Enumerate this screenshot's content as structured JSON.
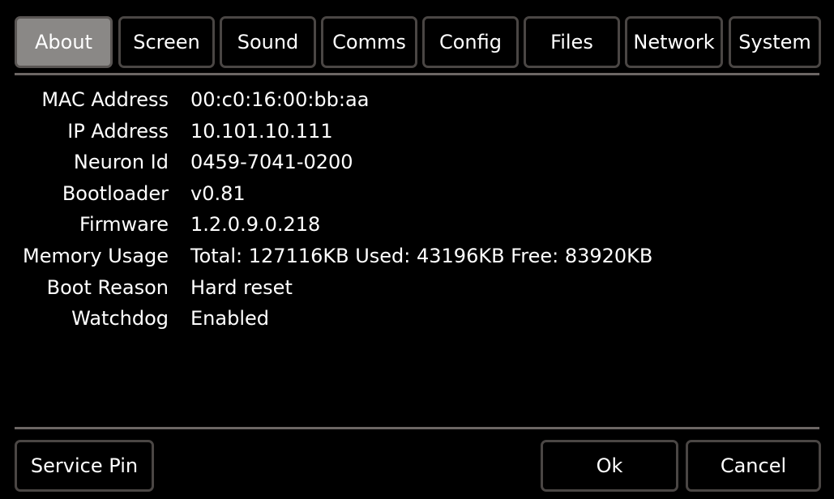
{
  "tabs": [
    {
      "label": "About",
      "active": true
    },
    {
      "label": "Screen",
      "active": false
    },
    {
      "label": "Sound",
      "active": false
    },
    {
      "label": "Comms",
      "active": false
    },
    {
      "label": "Config",
      "active": false
    },
    {
      "label": "Files",
      "active": false
    },
    {
      "label": "Network",
      "active": false
    },
    {
      "label": "System",
      "active": false
    }
  ],
  "about": {
    "rows": [
      {
        "label": "MAC Address",
        "value": "00:c0:16:00:bb:aa"
      },
      {
        "label": "IP Address",
        "value": "10.101.10.111"
      },
      {
        "label": "Neuron Id",
        "value": "0459-7041-0200"
      },
      {
        "label": "Bootloader",
        "value": "v0.81"
      },
      {
        "label": "Firmware",
        "value": "1.2.0.9.0.218"
      },
      {
        "label": "Memory Usage",
        "value": "Total: 127116KB Used: 43196KB Free: 83920KB"
      },
      {
        "label": "Boot Reason",
        "value": "Hard reset"
      },
      {
        "label": "Watchdog",
        "value": "Enabled"
      }
    ]
  },
  "footer": {
    "service_pin_label": "Service Pin",
    "ok_label": "Ok",
    "cancel_label": "Cancel"
  },
  "colors": {
    "background": "#000000",
    "text": "#ffffff",
    "border": "#4a4644",
    "active_tab": "#8a8886",
    "rule": "#6c6664"
  }
}
